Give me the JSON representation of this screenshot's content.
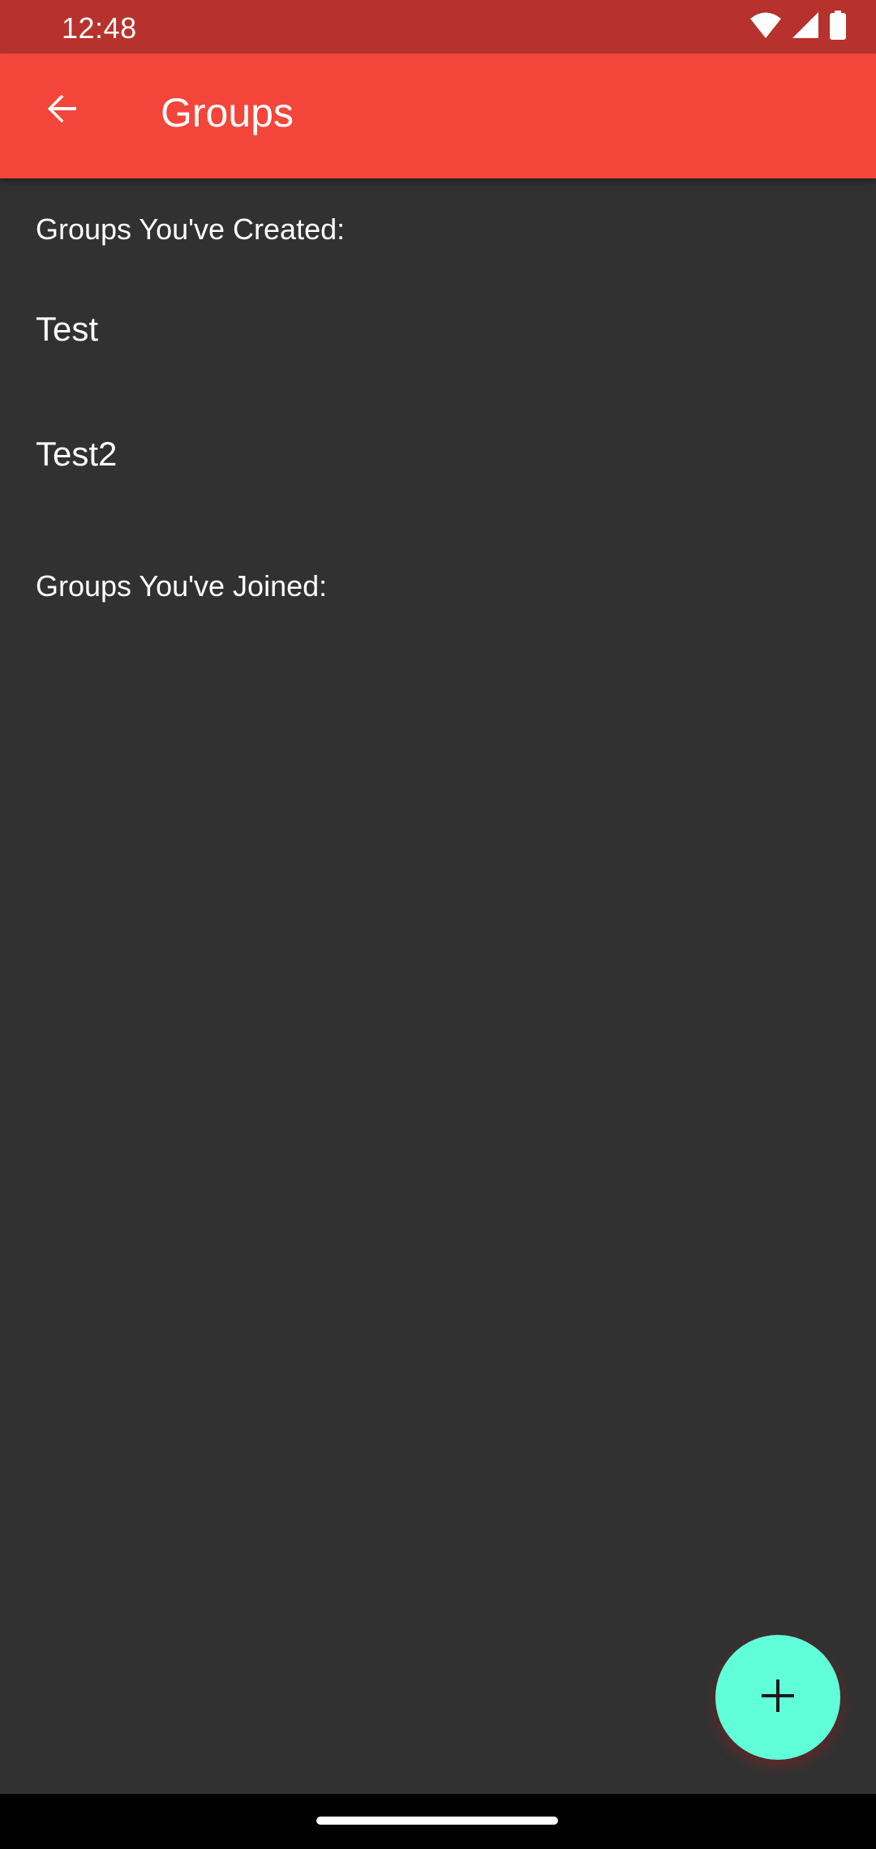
{
  "status_bar": {
    "time": "12:48",
    "icons": [
      "wifi-icon",
      "cellular-signal-icon",
      "battery-icon"
    ]
  },
  "app_bar": {
    "title": "Groups",
    "back_icon": "arrow-back-icon"
  },
  "sections": {
    "created": {
      "header": "Groups You've Created:",
      "items": [
        {
          "label": "Test"
        },
        {
          "label": "Test2"
        }
      ]
    },
    "joined": {
      "header": "Groups You've Joined:",
      "items": []
    }
  },
  "fab": {
    "icon": "plus-icon"
  },
  "colors": {
    "status_bar": "#b7322c",
    "app_bar": "#f4453b",
    "background": "#313131",
    "fab": "#60ffd9",
    "text": "#ffffff"
  }
}
